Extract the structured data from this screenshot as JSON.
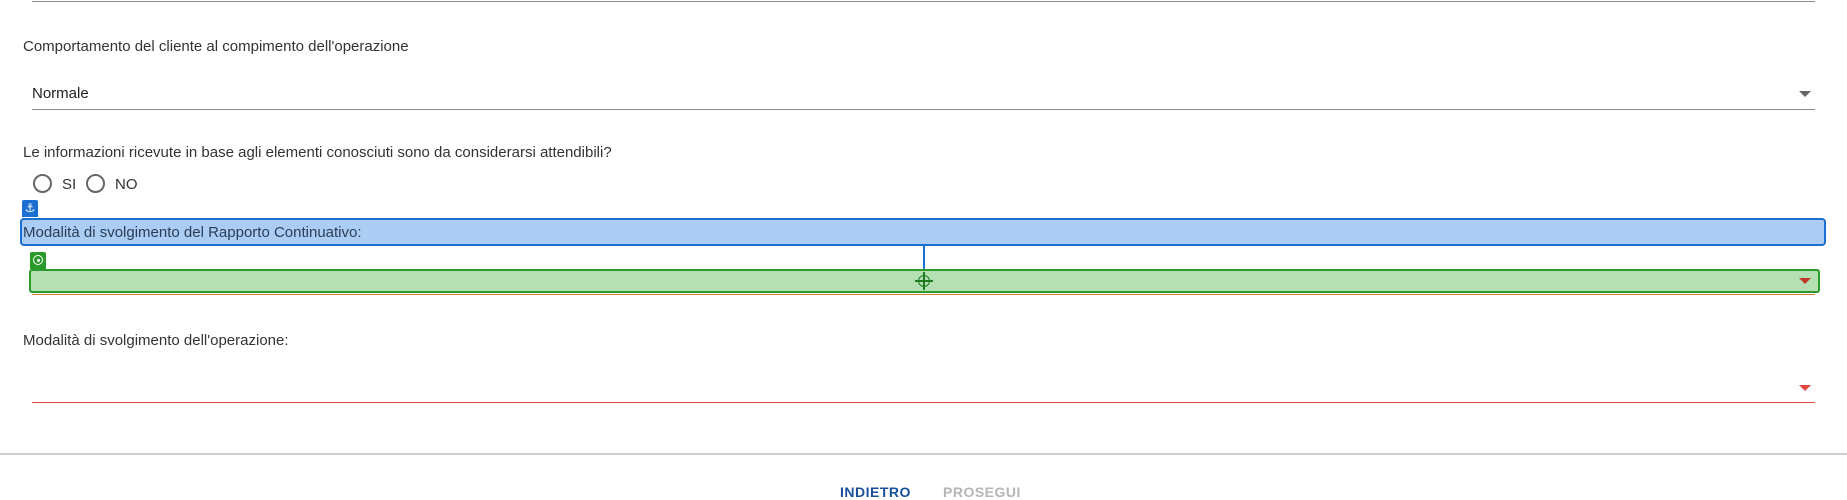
{
  "customer_behavior": {
    "label": "Comportamento del cliente al compimento dell'operazione",
    "selected_value": "Normale"
  },
  "reliability_question": {
    "label": "Le informazioni ricevute in base agli elementi conosciuti sono da considerarsi attendibili?",
    "options": [
      "SI",
      "NO"
    ]
  },
  "continuous_relationship_mode": {
    "label": "Modalità di svolgimento del Rapporto Continuativo:",
    "selected_value": ""
  },
  "operation_mode": {
    "label": "Modalità di svolgimento dell'operazione:",
    "selected_value": ""
  },
  "footer": {
    "back_label": "INDIETRO",
    "next_label": "PROSEGUI"
  },
  "colors": {
    "primary_blue": "#1a4f9c",
    "error_red": "#e0473c",
    "disabled_text": "#b5b5b5",
    "annotation_blue": "#1a6fd0",
    "annotation_green": "#2a9a2a"
  },
  "icons": {
    "dropdown": "caret-down-icon",
    "anchor_marker": "anchor-icon",
    "target_marker": "target-icon"
  }
}
